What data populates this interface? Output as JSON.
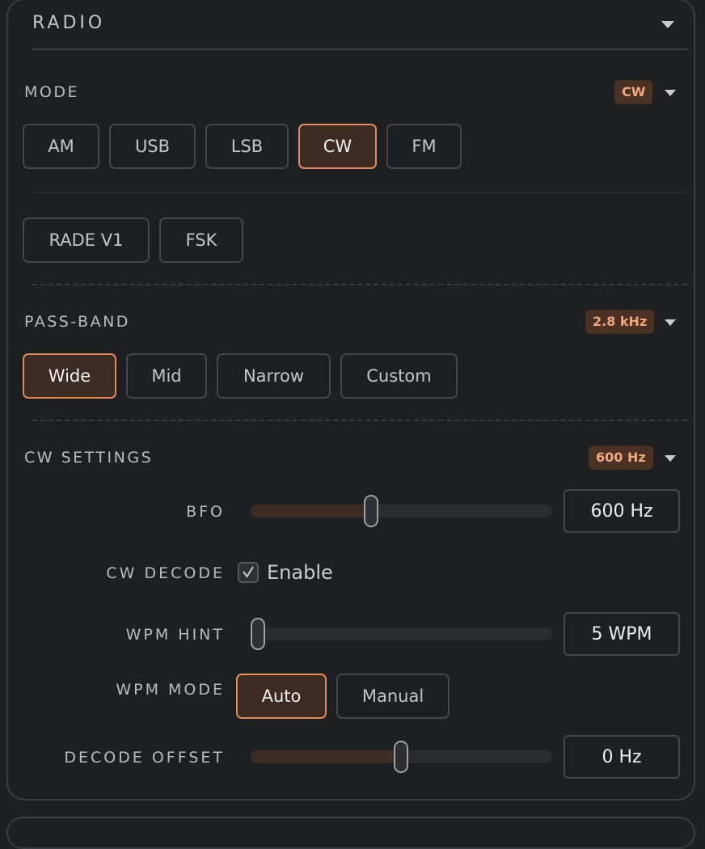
{
  "panel": {
    "title": "RADIO",
    "collapse_icon": "chevron-down-icon"
  },
  "mode": {
    "title": "MODE",
    "badge": "CW",
    "row1": [
      {
        "label": "AM",
        "active": false
      },
      {
        "label": "USB",
        "active": false
      },
      {
        "label": "LSB",
        "active": false
      },
      {
        "label": "CW",
        "active": true
      },
      {
        "label": "FM",
        "active": false
      }
    ],
    "row2": [
      {
        "label": "RADE V1",
        "active": false
      },
      {
        "label": "FSK",
        "active": false
      }
    ]
  },
  "passband": {
    "title": "PASS-BAND",
    "badge": "2.8 kHz",
    "buttons": [
      {
        "label": "Wide",
        "active": true
      },
      {
        "label": "Mid",
        "active": false
      },
      {
        "label": "Narrow",
        "active": false
      },
      {
        "label": "Custom",
        "active": false
      }
    ]
  },
  "cw_settings": {
    "title": "CW SETTINGS",
    "badge": "600 Hz",
    "bfo": {
      "label": "BFO",
      "value": "600 Hz",
      "level": 0.4
    },
    "decode": {
      "label": "CW DECODE",
      "checkbox_label": "Enable",
      "checked": true
    },
    "wpm_hint": {
      "label": "WPM HINT",
      "value": "5 WPM",
      "level": 0.0
    },
    "wpm_mode": {
      "label": "WPM MODE",
      "buttons": [
        {
          "label": "Auto",
          "active": true
        },
        {
          "label": "Manual",
          "active": false
        }
      ]
    },
    "decode_offset": {
      "label": "DECODE OFFSET",
      "value": "0 Hz",
      "level": 0.5
    }
  },
  "colors": {
    "accent": "#e08a5f",
    "accent_bg": "#3d2a20",
    "badge_bg": "#4a3124",
    "badge_text": "#f0a77f",
    "panel_bg": "#1e1f21",
    "border": "#44474c"
  }
}
